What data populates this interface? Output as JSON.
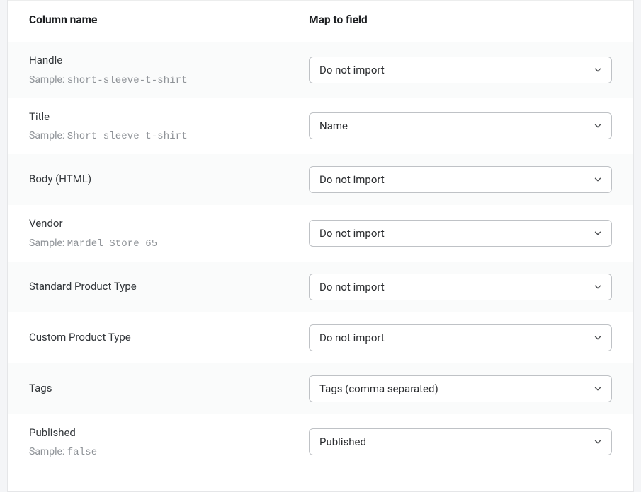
{
  "headers": {
    "column_name": "Column name",
    "map_to_field": "Map to field"
  },
  "sample_label": "Sample:",
  "rows": [
    {
      "name": "Handle",
      "sample": "short-sleeve-t-shirt",
      "selected": "Do not import"
    },
    {
      "name": "Title",
      "sample": "Short sleeve t-shirt",
      "selected": "Name"
    },
    {
      "name": "Body (HTML)",
      "sample": null,
      "selected": "Do not import"
    },
    {
      "name": "Vendor",
      "sample": "Mardel Store 65",
      "selected": "Do not import"
    },
    {
      "name": "Standard Product Type",
      "sample": null,
      "selected": "Do not import"
    },
    {
      "name": "Custom Product Type",
      "sample": null,
      "selected": "Do not import"
    },
    {
      "name": "Tags",
      "sample": null,
      "selected": "Tags (comma separated)"
    },
    {
      "name": "Published",
      "sample": "false",
      "selected": "Published"
    }
  ]
}
